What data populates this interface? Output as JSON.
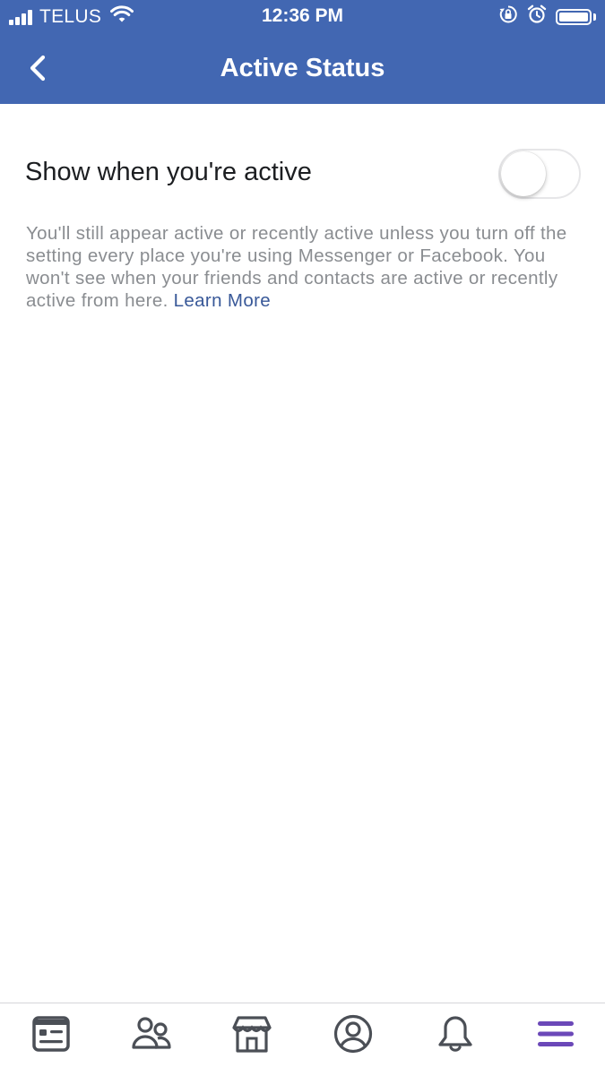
{
  "status_bar": {
    "carrier": "TELUS",
    "time": "12:36 PM"
  },
  "header": {
    "title": "Active Status",
    "back_icon": "chevron-left-icon"
  },
  "setting": {
    "label": "Show when you're active",
    "toggle_on": false
  },
  "description": {
    "text": "You'll still appear active or recently active unless you turn off the setting every place you're using Messenger or Facebook. You won't see when your friends and contacts are active or recently active from here.",
    "link": "Learn More"
  },
  "tabbar": {
    "tabs": [
      {
        "icon": "news-feed-icon",
        "active": false
      },
      {
        "icon": "friends-icon",
        "active": false
      },
      {
        "icon": "marketplace-icon",
        "active": false
      },
      {
        "icon": "profile-icon",
        "active": false
      },
      {
        "icon": "notifications-bell-icon",
        "active": false
      },
      {
        "icon": "menu-icon",
        "active": true
      }
    ]
  },
  "colors": {
    "header_blue": "#4267b2",
    "link_blue": "#385898",
    "active_tab_purple": "#6b48b8",
    "inactive_tab_gray": "#4b4f56",
    "description_gray": "#8a8d91"
  }
}
